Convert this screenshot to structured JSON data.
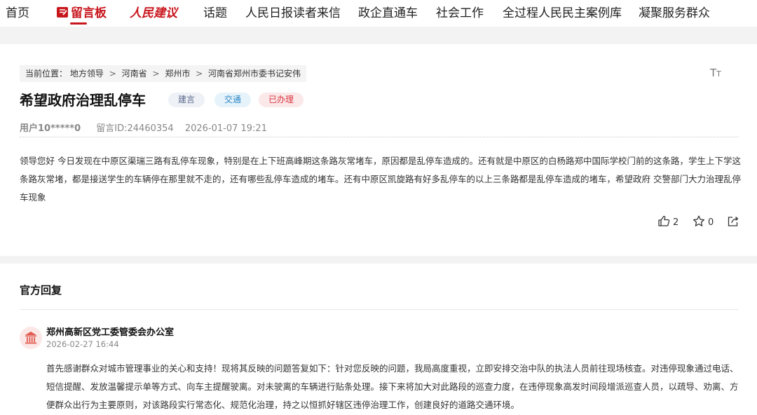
{
  "nav": {
    "items": [
      {
        "label": "首页"
      },
      {
        "label": "留言板",
        "active": true,
        "icon": "message-board-icon"
      },
      {
        "label": "人民建议",
        "icon": "brand-logo"
      },
      {
        "label": "话题"
      },
      {
        "label": "人民日报读者来信"
      },
      {
        "label": "政企直通车"
      },
      {
        "label": "社会工作"
      },
      {
        "label": "全过程人民民主案例库"
      },
      {
        "label": "凝聚服务群众"
      }
    ]
  },
  "breadcrumb": {
    "prefix": "当前位置：",
    "items": [
      "地方领导",
      "河南省",
      "郑州市",
      "河南省郑州市委书记安伟"
    ],
    "separator": ">"
  },
  "font_size_icon": {
    "big": "T",
    "small": "T"
  },
  "message": {
    "title": "希望政府治理乱停车",
    "tags": [
      {
        "label": "建言"
      },
      {
        "label": "交通"
      },
      {
        "label": "已办理"
      }
    ],
    "user": "用户10*****0",
    "message_id": "留言ID:24460354",
    "date": "2026-01-07 19:21",
    "content": "领导您好 今日发现在中原区渠瑞三路有乱停车现象，特别是在上下班高峰期这条路灰常堵车，原因都是乱停车造成的。还有就是中原区的白杨路郑中国际学校门前的这条路，学生上下学这条路灰常堵，都是接送学生的车辆停在那里就不走的，还有哪些乱停车造成的堵车。还有中原区凯旋路有好多乱停车的以上三条路都是乱停车造成的堵车，希望政府 交警部门大力治理乱停车现象",
    "like_count": "2",
    "favorite_count": "0"
  },
  "official_reply": {
    "section_title": "官方回复",
    "org_name": "郑州高新区党工委管委会办公室",
    "date": "2026-02-27 16:44",
    "content": "首先感谢群众对城市管理事业的关心和支持！现将其反映的问题答复如下：针对您反映的问题，我局高度重视，立即安排交治中队的执法人员前往现场核查。对违停现象通过电话、短信提醒、发放温馨提示单等方式、向车主提醒驶离。对未驶离的车辆进行贴条处理。接下来将加大对此路段的巡查力度，在违停现象高发时间段增派巡查人员，以疏导、劝离、方便群众出行为主要原则，对该路段实行常态化、规范化治理，持之以恒抓好辖区违停治理工作，创建良好的道路交通环境。"
  },
  "colors": {
    "accent": "#c8161d",
    "tag_suggest_bg": "#eef1f6",
    "tag_traffic_bg": "#e6f3fb",
    "tag_done_bg": "#fbe9ea"
  }
}
